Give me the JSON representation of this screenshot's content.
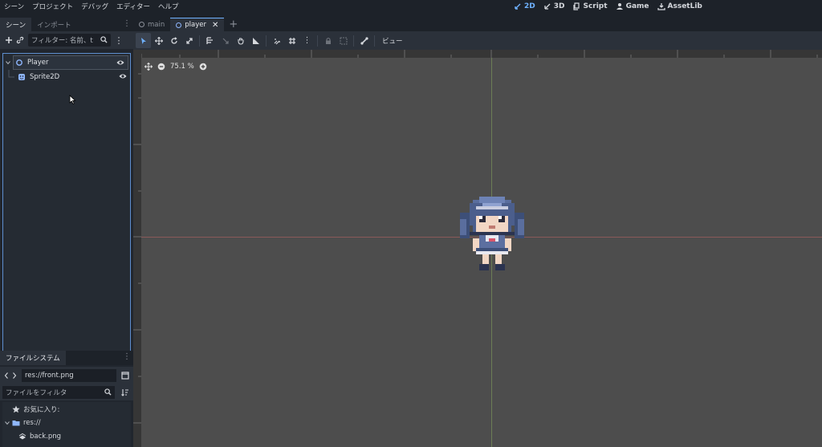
{
  "menu": [
    "シーン",
    "プロジェクト",
    "デバッグ",
    "エディター",
    "ヘルプ"
  ],
  "workspaces": [
    {
      "label": "2D",
      "icon": "2d-icon",
      "active": true
    },
    {
      "label": "3D",
      "icon": "3d-icon",
      "active": false
    },
    {
      "label": "Script",
      "icon": "script-icon",
      "active": false
    },
    {
      "label": "Game",
      "icon": "game-icon",
      "active": false
    },
    {
      "label": "AssetLib",
      "icon": "assetlib-icon",
      "active": false
    }
  ],
  "scene_dock": {
    "tabs": [
      "シーン",
      "インポート"
    ],
    "filter_placeholder": "フィルター: 名前、t",
    "nodes": [
      {
        "name": "Player",
        "icon": "node2d-icon",
        "selected": true
      },
      {
        "name": "Sprite2D",
        "icon": "sprite2d-icon",
        "selected": false
      }
    ]
  },
  "filesystem": {
    "tab": "ファイルシステム",
    "path": "res://front.png",
    "filter_placeholder": "ファイルをフィルタ",
    "items": [
      {
        "label": "お気に入り:",
        "icon": "star-icon"
      },
      {
        "label": "res://",
        "icon": "folder-icon"
      },
      {
        "label": "back.png",
        "icon": "image-file-icon"
      }
    ]
  },
  "editor": {
    "tabs": [
      {
        "label": "main",
        "active": false
      },
      {
        "label": "player",
        "active": true
      }
    ],
    "toolbar_view_label": "ビュー",
    "zoom_label": "75.1 %"
  },
  "colors": {
    "accent": "#6fb2ff",
    "viewport_bg": "#4d4d4d",
    "axis_x": "#8a5a5a",
    "axis_y": "#6c7d56"
  }
}
